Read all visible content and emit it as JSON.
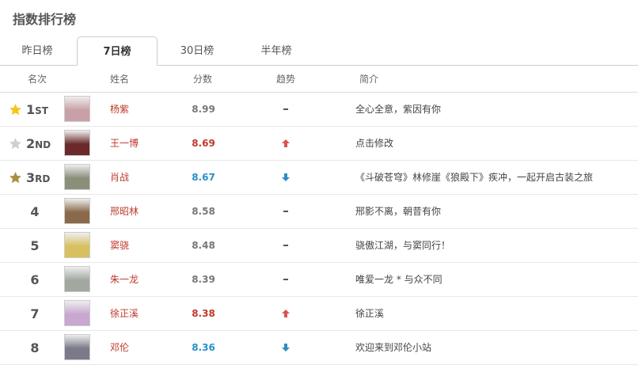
{
  "title": "指数排行榜",
  "tabs": [
    {
      "label": "昨日榜",
      "active": false
    },
    {
      "label": "7日榜",
      "active": true
    },
    {
      "label": "30日榜",
      "active": false
    },
    {
      "label": "半年榜",
      "active": false
    }
  ],
  "columns": {
    "rank": "名次",
    "name": "姓名",
    "score": "分数",
    "trend": "趋势",
    "intro": "简介"
  },
  "colors": {
    "gold": "#f5c518",
    "silver": "#cfcfcf",
    "bronze": "#a89040",
    "up": "#d9534f",
    "down": "#2a8fc8",
    "flat": "#555555"
  },
  "rows": [
    {
      "rank": "1",
      "suffix": "ST",
      "medal": "gold",
      "name": "杨紫",
      "score": "8.99",
      "score_color": "gray",
      "trend": "flat",
      "intro": "全心全意，紫因有你",
      "avatar_color": "#c9a0a8"
    },
    {
      "rank": "2",
      "suffix": "ND",
      "medal": "silver",
      "name": "王一博",
      "score": "8.69",
      "score_color": "red",
      "trend": "up",
      "intro": "点击修改",
      "avatar_color": "#6a2a2a"
    },
    {
      "rank": "3",
      "suffix": "RD",
      "medal": "bronze",
      "name": "肖战",
      "score": "8.67",
      "score_color": "blue",
      "trend": "down",
      "intro": "《斗破苍穹》林修崖《狼殿下》疾冲，一起开启古装之旅",
      "avatar_color": "#8a8f7a"
    },
    {
      "rank": "4",
      "suffix": "",
      "medal": "",
      "name": "邢昭林",
      "score": "8.58",
      "score_color": "gray",
      "trend": "flat",
      "intro": "邢影不离，朝昔有你",
      "avatar_color": "#8a6a4a"
    },
    {
      "rank": "5",
      "suffix": "",
      "medal": "",
      "name": "窦骁",
      "score": "8.48",
      "score_color": "gray",
      "trend": "flat",
      "intro": "骁傲江湖，与窦同行！",
      "avatar_color": "#d8c060"
    },
    {
      "rank": "6",
      "suffix": "",
      "medal": "",
      "name": "朱一龙",
      "score": "8.39",
      "score_color": "gray",
      "trend": "flat",
      "intro": "唯爱一龙 * 与众不同",
      "avatar_color": "#a0a8a0"
    },
    {
      "rank": "7",
      "suffix": "",
      "medal": "",
      "name": "徐正溪",
      "score": "8.38",
      "score_color": "red",
      "trend": "up",
      "intro": "徐正溪",
      "avatar_color": "#c8a8d0"
    },
    {
      "rank": "8",
      "suffix": "",
      "medal": "",
      "name": "邓伦",
      "score": "8.36",
      "score_color": "blue",
      "trend": "down",
      "intro": "欢迎来到邓伦小站",
      "avatar_color": "#7a7a88"
    }
  ]
}
